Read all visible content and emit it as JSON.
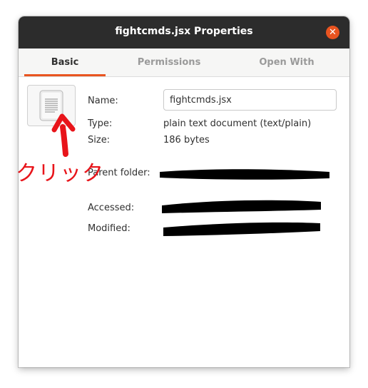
{
  "window": {
    "title": "fightcmds.jsx Properties",
    "close_icon": "close-icon"
  },
  "tabs": [
    {
      "label": "Basic",
      "active": true
    },
    {
      "label": "Permissions",
      "active": false
    },
    {
      "label": "Open With",
      "active": false
    }
  ],
  "basic": {
    "file_icon": "text-document-icon",
    "name_label": "Name:",
    "name_value": "fightcmds.jsx",
    "type_label": "Type:",
    "type_value": "plain text document (text/plain)",
    "size_label": "Size:",
    "size_value": "186 bytes",
    "parent_folder_label": "Parent folder:",
    "accessed_label": "Accessed:",
    "modified_label": "Modified:"
  },
  "annotation": {
    "text": "クリック",
    "color": "#e8141a"
  },
  "colors": {
    "accent": "#e95420",
    "titlebar": "#2c2c2c"
  }
}
